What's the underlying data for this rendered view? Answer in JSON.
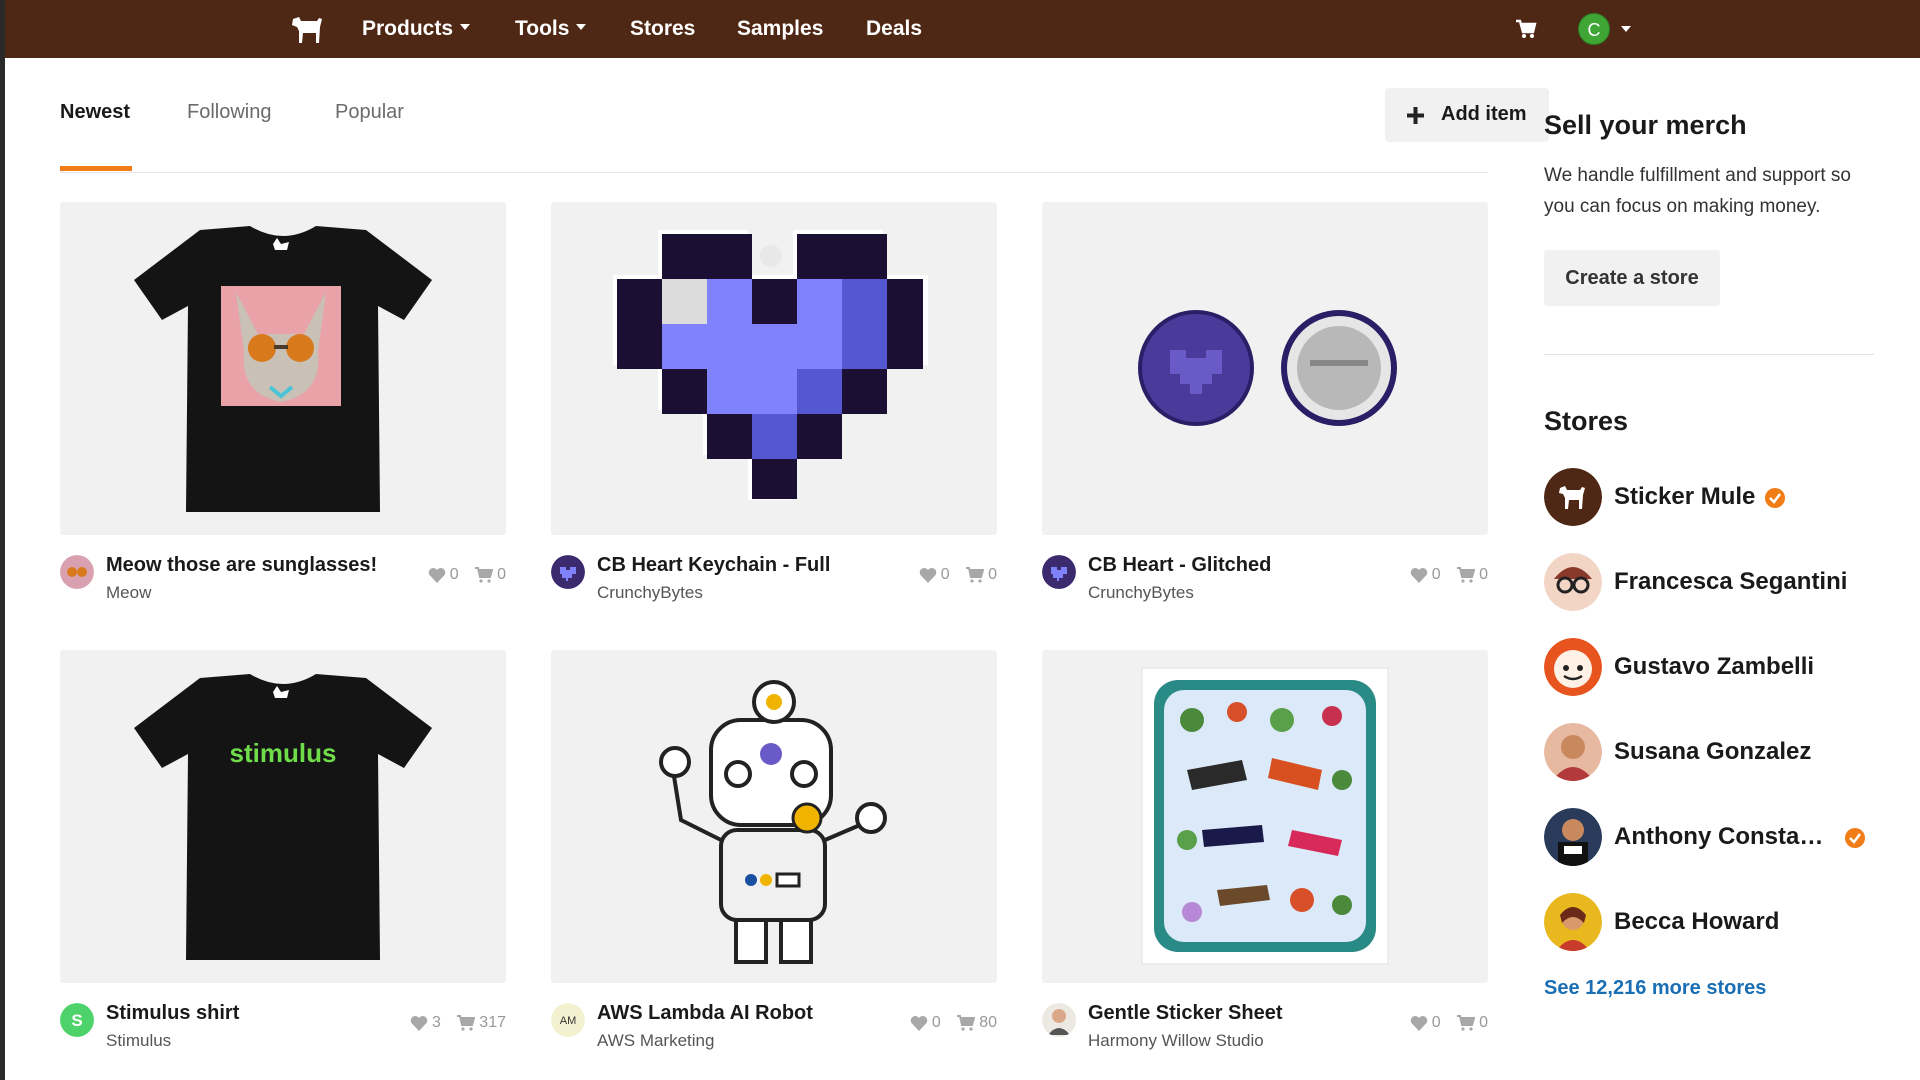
{
  "colors": {
    "nav_bg": "#4f2815",
    "accent_orange": "#f07d16",
    "link_blue": "#1a6fb4",
    "card_bg": "#f1f1f1"
  },
  "nav": {
    "logo_icon": "mule-logo-icon",
    "items": [
      "Products",
      "Tools",
      "Stores",
      "Samples",
      "Deals"
    ],
    "cart_icon": "cart-icon",
    "user_initial": "C"
  },
  "tabs": {
    "items": [
      "Newest",
      "Following",
      "Popular"
    ],
    "active": "Newest"
  },
  "add_item_label": "Add item",
  "products": [
    {
      "title": "Meow those are sunglasses!",
      "store": "Meow",
      "likes": "0",
      "orders": "0",
      "image": "cat-sunglasses-tshirt"
    },
    {
      "title": "CB Heart Keychain - Full",
      "store": "CrunchyBytes",
      "likes": "0",
      "orders": "0",
      "image": "pixel-heart-keychain"
    },
    {
      "title": "CB Heart - Glitched",
      "store": "CrunchyBytes",
      "likes": "0",
      "orders": "0",
      "image": "heart-buttons"
    },
    {
      "title": "Stimulus shirt",
      "store": "Stimulus",
      "likes": "3",
      "orders": "317",
      "image": "stimulus-tshirt"
    },
    {
      "title": "AWS Lambda AI Robot",
      "store": "AWS Marketing",
      "likes": "0",
      "orders": "80",
      "image": "robot-sticker",
      "avatar_text": "AM"
    },
    {
      "title": "Gentle Sticker Sheet",
      "store": "Harmony Willow Studio",
      "likes": "0",
      "orders": "0",
      "image": "plant-sticker-sheet"
    }
  ],
  "sidebar": {
    "sell_title": "Sell your merch",
    "sell_text": "We handle fulfillment and support so you can focus on making money.",
    "create_store": "Create a store",
    "stores_title": "Stores",
    "stores": [
      {
        "name": "Sticker Mule",
        "verified": true
      },
      {
        "name": "Francesca Segantini",
        "verified": false
      },
      {
        "name": "Gustavo Zambelli",
        "verified": false
      },
      {
        "name": "Susana Gonzalez",
        "verified": false
      },
      {
        "name": "Anthony Consta…",
        "verified": true
      },
      {
        "name": "Becca Howard",
        "verified": false
      }
    ],
    "see_more": "See 12,216 more stores"
  }
}
